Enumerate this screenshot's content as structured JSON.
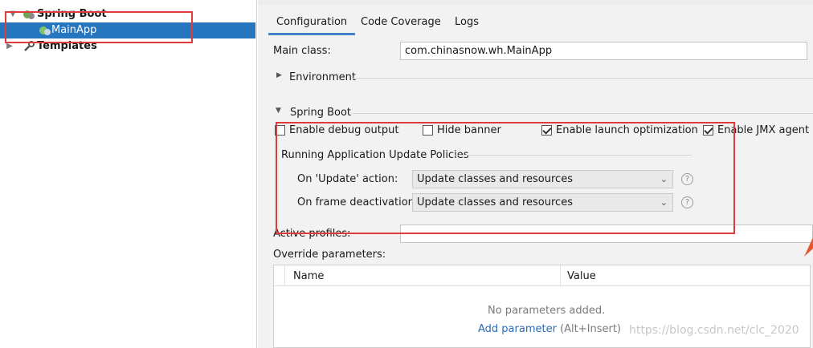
{
  "tree": {
    "spring_boot": "Spring Boot",
    "main_app": "MainApp",
    "templates": "Templates"
  },
  "tabs": [
    "Configuration",
    "Code Coverage",
    "Logs"
  ],
  "main_class": {
    "label": "Main class:",
    "value": "com.chinasnow.wh.MainApp"
  },
  "sections": {
    "environment": "Environment",
    "spring_boot": "Spring Boot"
  },
  "checkboxes": [
    {
      "label": "Enable debug output",
      "checked": false
    },
    {
      "label": "Hide banner",
      "checked": false
    },
    {
      "label": "Enable launch optimization",
      "checked": true
    },
    {
      "label": "Enable JMX agent",
      "checked": true
    }
  ],
  "policies": {
    "title": "Running Application Update Policies",
    "update_action": {
      "label": "On 'Update' action:",
      "value": "Update classes and resources"
    },
    "frame_deactivation": {
      "label": "On frame deactivation:",
      "value": "Update classes and resources"
    },
    "help_glyph": "?"
  },
  "active_profiles": {
    "label": "Active profiles:",
    "value": ""
  },
  "override": {
    "label": "Override parameters:",
    "columns": [
      "Name",
      "Value"
    ],
    "empty_text": "No parameters added.",
    "add_link": "Add parameter",
    "add_shortcut": "(Alt+Insert)"
  },
  "watermark": "https://blog.csdn.net/clc_2020",
  "colors": {
    "selection": "#2675bf",
    "highlight_box": "#e03b3b",
    "link": "#2b6cb3"
  }
}
